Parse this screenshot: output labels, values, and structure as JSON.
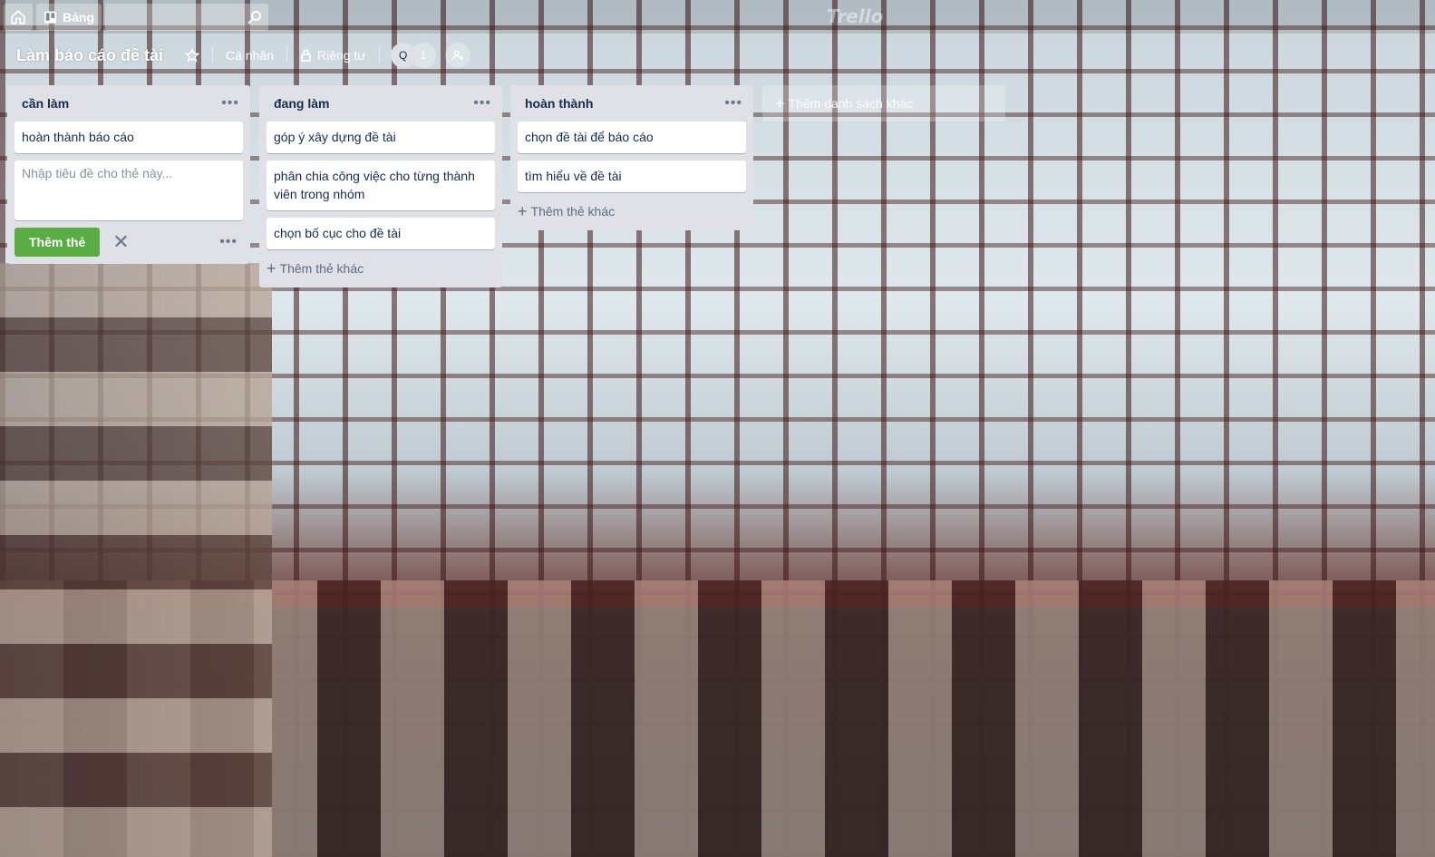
{
  "topbar": {
    "boards_label": "Bảng",
    "search_placeholder": "",
    "logo": "Trello"
  },
  "board": {
    "title": "Làm báo cáo đề tài",
    "team_label": "Cá nhân",
    "visibility_label": "Riêng tư",
    "member_initial": "Q",
    "member_count": "1"
  },
  "lists": [
    {
      "title": "cần làm",
      "cards": [
        "hoàn thành báo cáo"
      ],
      "composer": {
        "placeholder": "Nhập tiêu đề cho thẻ này...",
        "add_label": "Thêm thẻ"
      }
    },
    {
      "title": "đang làm",
      "cards": [
        "góp ý xây dựng đề tài",
        "phân chia công việc cho từng thành viên trong nhóm",
        "chọn bố cục cho đề tài"
      ],
      "add_card_label": "Thêm thẻ khác"
    },
    {
      "title": "hoàn thành",
      "cards": [
        "chọn đề tài để báo cáo",
        "tìm hiểu về đề tài"
      ],
      "add_card_label": "Thêm thẻ khác"
    }
  ],
  "add_list_label": "Thêm danh sách khác",
  "colors": {
    "list_bg": "#dfe1e6",
    "add_button": "#5aac44",
    "text": "#172b4d"
  }
}
